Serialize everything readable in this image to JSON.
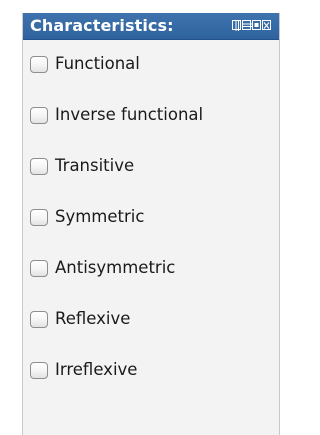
{
  "panel": {
    "title": "Characteristics:",
    "controls": [
      "view-toggle-icon",
      "minimize-icon",
      "maximize-icon",
      "close-icon"
    ]
  },
  "characteristics": [
    {
      "label": "Functional",
      "checked": false
    },
    {
      "label": "Inverse functional",
      "checked": false
    },
    {
      "label": "Transitive",
      "checked": false
    },
    {
      "label": "Symmetric",
      "checked": false
    },
    {
      "label": "Antisymmetric",
      "checked": false
    },
    {
      "label": "Reflexive",
      "checked": false
    },
    {
      "label": "Irreflexive",
      "checked": false
    }
  ],
  "colors": {
    "header": "#3f73ad",
    "panel_bg": "#f3f3f3",
    "text": "#1a1a1a"
  }
}
